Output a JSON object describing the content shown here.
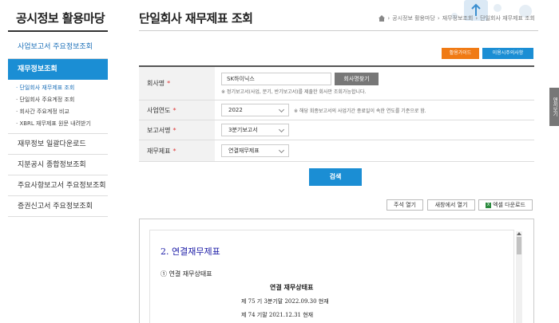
{
  "sidebar": {
    "title": "공시정보 활용마당",
    "items": [
      {
        "label": "사업보고서 주요정보조회"
      },
      {
        "label": "재무정보조회"
      },
      {
        "label": "재무정보 일괄다운로드"
      },
      {
        "label": "지분공시 종합정보조회"
      },
      {
        "label": "주요사항보고서 주요정보조회"
      },
      {
        "label": "증권신고서 주요정보조회"
      }
    ],
    "subitems": [
      {
        "label": "· 단일회사 재무제표 조회"
      },
      {
        "label": "· 단일회사 주요계정 조회"
      },
      {
        "label": "· 회사간 주요계정 비교"
      },
      {
        "label": "· XBRL 재무제표 원문 내려받기"
      }
    ]
  },
  "header": {
    "title": "단일회사 재무제표 조회",
    "breadcrumb": [
      "공시정보 활용마당",
      "재무정보조회",
      "단일회사 재무제표 조회"
    ]
  },
  "top_buttons": {
    "guide": "활용가이드",
    "notice": "이용시주의사항"
  },
  "side_tab": {
    "label": "맨끼보기"
  },
  "form": {
    "company": {
      "label": "회사명",
      "value": "SK하이닉스",
      "find_button": "회사명찾기",
      "note": "※ 정기보고서(사업, 분기, 반기보고서)를 제출한 회사만 조회가능합니다."
    },
    "year": {
      "label": "사업연도",
      "value": "2022",
      "note": "※ 해당 회종보고서의 사업기간 종료일이 속한 연도를 기준으로 함."
    },
    "report": {
      "label": "보고서명",
      "value": "3분기보고서"
    },
    "statement": {
      "label": "재무제표",
      "value": "연결재무제표"
    },
    "required_mark": "*"
  },
  "search_button": "검색",
  "actions": {
    "notes": "주석 열기",
    "new_window": "새창에서 열기",
    "excel": "엑셀 다운로드",
    "excel_icon": "X"
  },
  "document": {
    "title": "2. 연결재무제표",
    "subtitle": "① 연결 재무상태표",
    "statement_title": "연결 재무상태표",
    "period1": "제 75 기 3분기말 2022.09.30 현재",
    "period2": "제 74 기말        2021.12.31 현재"
  }
}
